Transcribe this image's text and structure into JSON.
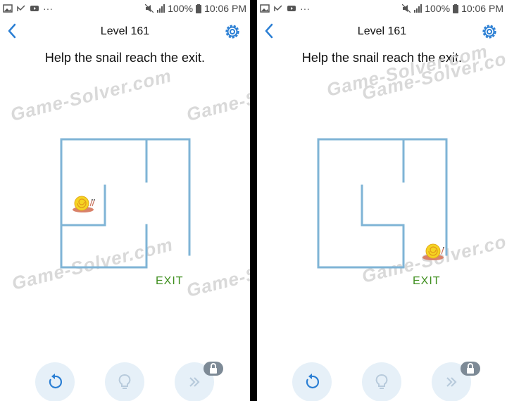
{
  "status_bar": {
    "battery_percent": "100%",
    "time": "10:06 PM"
  },
  "header": {
    "level_title": "Level 161"
  },
  "prompt": "Help the snail reach the exit.",
  "watermark": "Game-Solver.com",
  "exit_label": "EXIT",
  "colors": {
    "maze_wall": "#7fb4d6",
    "exit_text": "#3f8f1f",
    "accent_blue": "#2b7fd4",
    "button_bg": "#e6f0f8"
  },
  "icons": [
    "back-arrow-icon",
    "gear-icon",
    "snail-icon",
    "restart-icon",
    "hint-bulb-icon",
    "skip-icon",
    "lock-icon"
  ]
}
